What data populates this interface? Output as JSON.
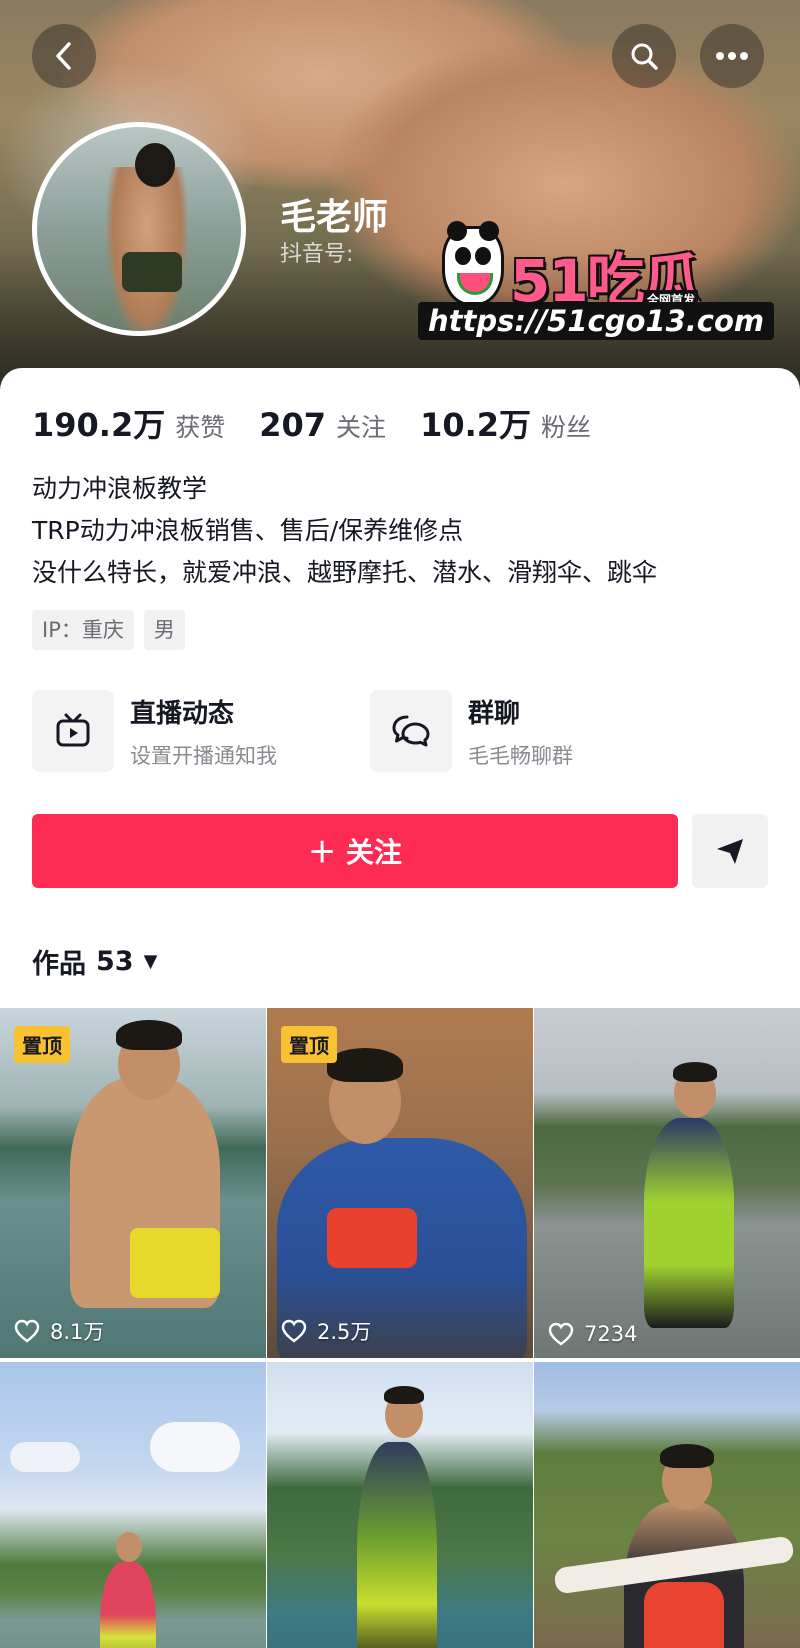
{
  "header": {
    "name": "毛老师",
    "douyin_id_label": "抖音号:"
  },
  "watermark": {
    "brand": "51吃瓜",
    "tag": "全网首发",
    "url": "https://51cgo13.com"
  },
  "stats": [
    {
      "num": "190.2万",
      "label": "获赞"
    },
    {
      "num": "207",
      "label": "关注"
    },
    {
      "num": "10.2万",
      "label": "粉丝"
    }
  ],
  "bio": [
    "动力冲浪板教学",
    "TRP动力冲浪板销售、售后/保养维修点",
    "没什么特长，就爱冲浪、越野摩托、潜水、滑翔伞、跳伞"
  ],
  "tags": [
    "IP：重庆",
    "男"
  ],
  "features": [
    {
      "title": "直播动态",
      "subtitle": "设置开播通知我",
      "icon": "live-tv-icon"
    },
    {
      "title": "群聊",
      "subtitle": "毛毛畅聊群",
      "icon": "chat-icon"
    }
  ],
  "follow_label": "＋ 关注",
  "works": {
    "label": "作品",
    "count": "53",
    "caret": "▼"
  },
  "videos": [
    {
      "pinned": "置顶",
      "likes": "8.1万"
    },
    {
      "pinned": "置顶",
      "likes": "2.5万"
    },
    {
      "pinned": "",
      "likes": "7234"
    },
    {
      "pinned": "",
      "likes": ""
    },
    {
      "pinned": "",
      "likes": ""
    },
    {
      "pinned": "",
      "likes": ""
    }
  ],
  "colors": {
    "accent": "#fe2c55",
    "pin": "#f9c232"
  }
}
